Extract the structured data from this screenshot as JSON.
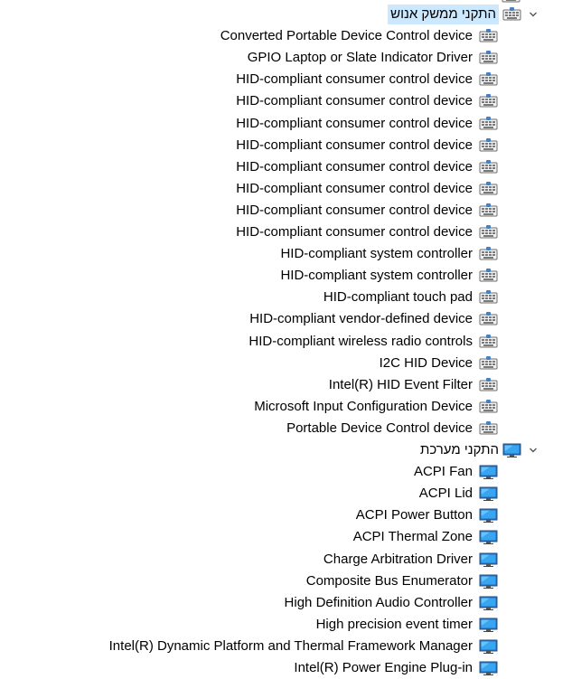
{
  "categories": [
    {
      "label": "התקני ממשק אנוש",
      "icon": "hid-device-icon",
      "expanded": true,
      "selected": true,
      "devices": [
        "Converted Portable Device Control device",
        "GPIO Laptop or Slate Indicator Driver",
        "HID-compliant consumer control device",
        "HID-compliant consumer control device",
        "HID-compliant consumer control device",
        "HID-compliant consumer control device",
        "HID-compliant consumer control device",
        "HID-compliant consumer control device",
        "HID-compliant consumer control device",
        "HID-compliant consumer control device",
        "HID-compliant system controller",
        "HID-compliant system controller",
        "HID-compliant touch pad",
        "HID-compliant vendor-defined device",
        "HID-compliant wireless radio controls",
        "I2C HID Device",
        "Intel(R) HID Event Filter",
        "Microsoft Input Configuration Device",
        "Portable Device Control device"
      ]
    },
    {
      "label": "התקני מערכת",
      "icon": "system-device-icon",
      "expanded": true,
      "selected": false,
      "devices": [
        "ACPI Fan",
        "ACPI Lid",
        "ACPI Power Button",
        "ACPI Thermal Zone",
        "Charge Arbitration Driver",
        "Composite Bus Enumerator",
        "High Definition Audio Controller",
        "High precision event timer",
        "Intel(R) Dynamic Platform and Thermal Framework Manager",
        "Intel(R) Power Engine Plug-in"
      ]
    }
  ],
  "colors": {
    "selection": "#cce8ff",
    "chevron": "#555555"
  }
}
